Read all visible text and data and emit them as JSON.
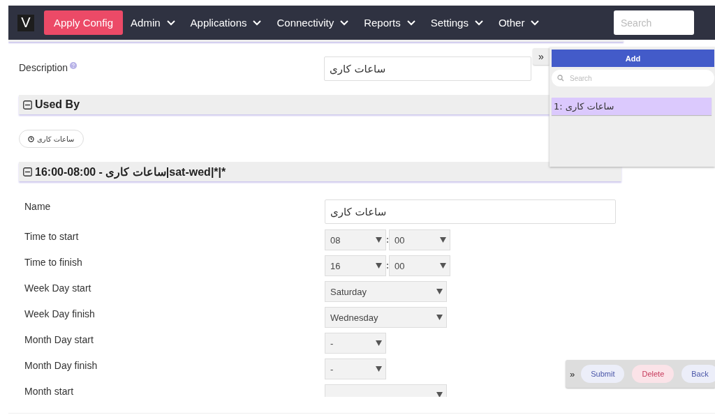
{
  "nav": {
    "logo": "V",
    "apply_button": "Apply Config",
    "menus": [
      "Admin",
      "Applications",
      "Connectivity",
      "Reports",
      "Settings",
      "Other"
    ],
    "search": {
      "placeholder": "Search"
    }
  },
  "description": {
    "label": "Description",
    "value": "ساعات کاری"
  },
  "used_by": {
    "title": "Used By",
    "expanded": true,
    "chips": [
      "ساعات کاری"
    ]
  },
  "schedule": {
    "title": "16:00-08:00 - ساعات کاری|sat-wed|*|*",
    "expanded": true,
    "fields": [
      {
        "kind": "text",
        "label": "Name",
        "value": "ساعات کاری"
      },
      {
        "kind": "time",
        "label": "Time to start",
        "hour": "08",
        "minute": "00"
      },
      {
        "kind": "time",
        "label": "Time to finish",
        "hour": "16",
        "minute": "00"
      },
      {
        "kind": "select",
        "label": "Week Day start",
        "value": "Saturday"
      },
      {
        "kind": "select",
        "label": "Week Day finish",
        "value": "Wednesday"
      },
      {
        "kind": "small-select",
        "label": "Month Day start",
        "value": "-"
      },
      {
        "kind": "small-select",
        "label": "Month Day finish",
        "value": "-"
      },
      {
        "kind": "select",
        "label": "Month start"
      }
    ]
  },
  "side_panel": {
    "collapse": "»",
    "add_button": "Add",
    "search": {
      "placeholder": "Search"
    },
    "items": [
      {
        "label": "1: ساعات کاری",
        "selected": true
      }
    ]
  },
  "actions": {
    "collapse": "»",
    "buttons": [
      {
        "label": "Submit",
        "kind": "primary"
      },
      {
        "label": "Delete",
        "kind": "danger"
      },
      {
        "label": "Back",
        "kind": "primary"
      }
    ]
  }
}
